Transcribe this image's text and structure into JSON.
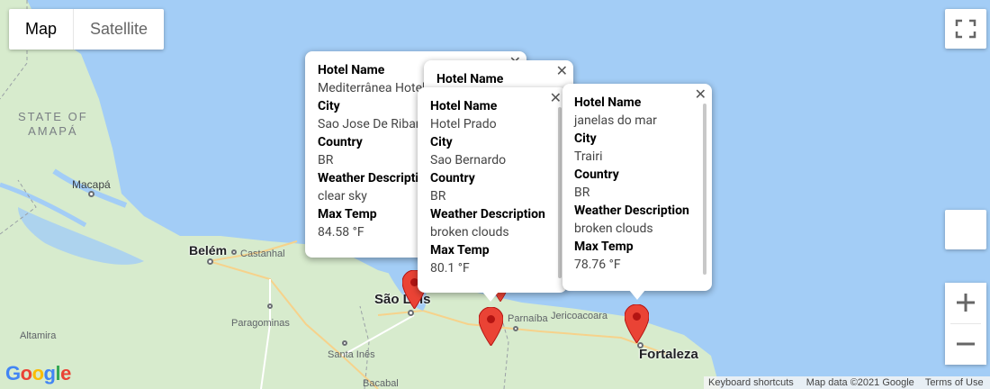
{
  "map_type": {
    "map_label": "Map",
    "satellite_label": "Satellite"
  },
  "labels": {
    "state": "STATE OF\nAMAPÁ",
    "macapa": "Macapá",
    "belem": "Belém",
    "castanhal": "Castanhal",
    "sao_luis": "São Luís",
    "paragominas": "Paragominas",
    "altamira": "Altamira",
    "santa_ines": "Santa Inês",
    "bacabal": "Bacabal",
    "parnaiba": "Parnaíba",
    "jericoacoara": "Jericoacoara",
    "fortaleza": "Fortaleza"
  },
  "info_windows": [
    {
      "hotel": "Mediterrânea Hotel",
      "city": "Sao Jose De Ribamar",
      "country": "BR",
      "weather": "clear sky",
      "temp": "84.58 °F"
    },
    {
      "hotel": "Hotel Name"
    },
    {
      "hotel": "Hotel Prado",
      "city": "Sao Bernardo",
      "country": "BR",
      "weather": "broken clouds",
      "temp": "80.1 °F"
    },
    {
      "hotel": "janelas do mar",
      "city": "Trairi",
      "country": "BR",
      "weather": "broken clouds",
      "temp": "78.76 °F"
    }
  ],
  "field_labels": {
    "hotel": "Hotel Name",
    "city": "City",
    "country": "Country",
    "weather": "Weather Description",
    "temp": "Max Temp"
  },
  "footer": {
    "shortcuts": "Keyboard shortcuts",
    "data": "Map data ©2021 Google",
    "terms": "Terms of Use"
  },
  "google_logo": "Google",
  "colors": {
    "water": "#a3cdf6",
    "land": "#d9ecd2",
    "marker": "#ea4335"
  }
}
